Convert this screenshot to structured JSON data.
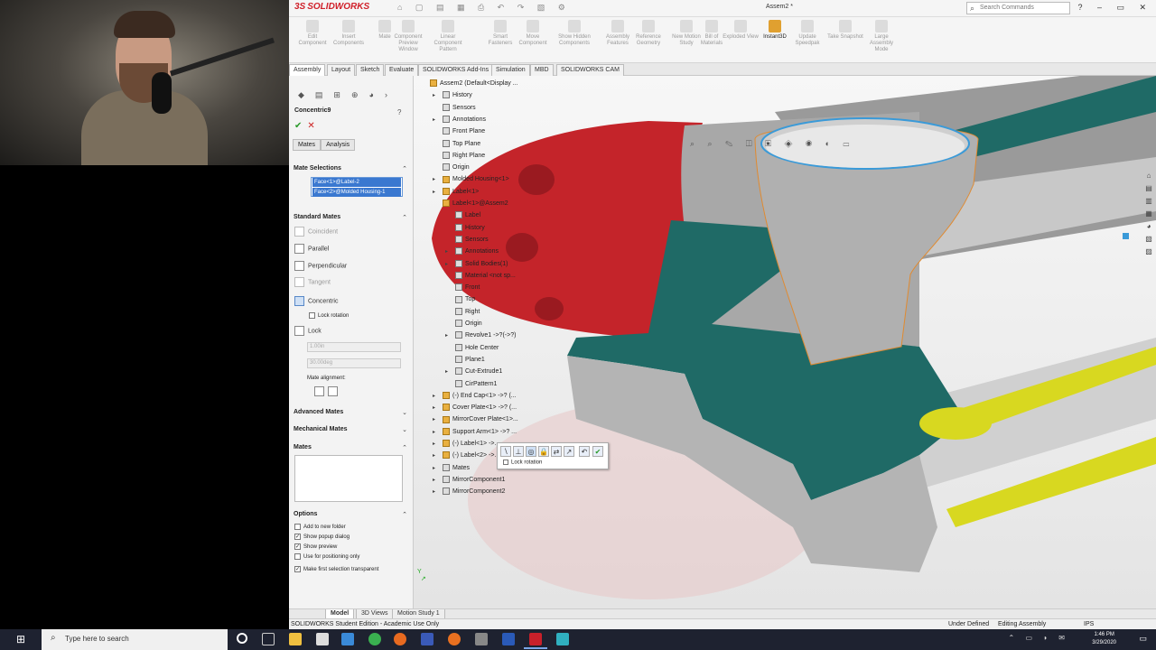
{
  "titlebar": {
    "logo": "SOLIDWORKS",
    "logo_prefix": "3S",
    "document_title": "Assem2 *",
    "search_placeholder": "Search Commands"
  },
  "ribbon": {
    "buttons": [
      {
        "label": "Edit Component",
        "icon": "edit-component-icon",
        "active": false
      },
      {
        "label": "Insert Components",
        "icon": "insert-components-icon",
        "active": false
      },
      {
        "label": "Mate",
        "icon": "mate-icon",
        "active": false
      },
      {
        "label": "Component Preview Window",
        "icon": "component-preview-icon",
        "active": false
      },
      {
        "label": "Linear Component Pattern",
        "icon": "linear-pattern-icon",
        "active": false
      },
      {
        "label": "Smart Fasteners",
        "icon": "smart-fasteners-icon",
        "active": false
      },
      {
        "label": "Move Component",
        "icon": "move-component-icon",
        "active": false
      },
      {
        "label": "Show Hidden Components",
        "icon": "show-hidden-icon",
        "active": false
      },
      {
        "label": "Assembly Features",
        "icon": "assembly-features-icon",
        "active": false
      },
      {
        "label": "Reference Geometry",
        "icon": "reference-geometry-icon",
        "active": false
      },
      {
        "label": "New Motion Study",
        "icon": "motion-study-icon",
        "active": false
      },
      {
        "label": "Bill of Materials",
        "icon": "bom-icon",
        "active": false
      },
      {
        "label": "Exploded View",
        "icon": "exploded-view-icon",
        "active": false
      },
      {
        "label": "Instant3D",
        "icon": "instant3d-icon",
        "active": true
      },
      {
        "label": "Update Speedpak",
        "icon": "speedpak-icon",
        "active": false
      },
      {
        "label": "Take Snapshot",
        "icon": "snapshot-icon",
        "active": false
      },
      {
        "label": "Large Assembly Mode",
        "icon": "large-assembly-icon",
        "active": false
      }
    ]
  },
  "tabs": [
    "Assembly",
    "Layout",
    "Sketch",
    "Evaluate",
    "SOLIDWORKS Add-Ins",
    "Simulation",
    "MBD",
    "SOLIDWORKS CAM"
  ],
  "property_manager": {
    "title": "Concentric9",
    "tab_mates": "Mates",
    "tab_analysis": "Analysis",
    "mate_selections_title": "Mate Selections",
    "selections": [
      "Face<1>@Label-2",
      "Face<2>@Molded Housing-1"
    ],
    "standard_mates_title": "Standard Mates",
    "mates": [
      {
        "label": "Coincident",
        "enabled": false
      },
      {
        "label": "Parallel",
        "enabled": true
      },
      {
        "label": "Perpendicular",
        "enabled": true
      },
      {
        "label": "Tangent",
        "enabled": false
      },
      {
        "label": "Concentric",
        "enabled": true,
        "selected": true
      }
    ],
    "lock_rotation": "Lock rotation",
    "lock": "Lock",
    "distance_value": "1.00in",
    "angle_value": "30.00deg",
    "mate_alignment": "Mate alignment:",
    "advanced_mates": "Advanced Mates",
    "mechanical_mates": "Mechanical Mates",
    "mates_list_title": "Mates",
    "options_title": "Options",
    "options": [
      {
        "label": "Add to new folder",
        "checked": false
      },
      {
        "label": "Show popup dialog",
        "checked": true
      },
      {
        "label": "Show preview",
        "checked": true
      },
      {
        "label": "Use for positioning only",
        "checked": false
      },
      {
        "label": "Make first selection transparent",
        "checked": true
      }
    ]
  },
  "tree": [
    {
      "label": "Assem2 (Default<Display ...",
      "indent": 0,
      "arrow": false,
      "yellow": true
    },
    {
      "label": "History",
      "indent": 1,
      "arrow": true
    },
    {
      "label": "Sensors",
      "indent": 1,
      "arrow": false
    },
    {
      "label": "Annotations",
      "indent": 1,
      "arrow": true
    },
    {
      "label": "Front Plane",
      "indent": 1,
      "arrow": false
    },
    {
      "label": "Top Plane",
      "indent": 1,
      "arrow": false
    },
    {
      "label": "Right Plane",
      "indent": 1,
      "arrow": false
    },
    {
      "label": "Origin",
      "indent": 1,
      "arrow": false
    },
    {
      "label": "Molded Housing<1>",
      "indent": 1,
      "arrow": true,
      "yellow": true
    },
    {
      "label": "Label<1>",
      "indent": 1,
      "arrow": true,
      "yellow": true
    },
    {
      "label": "Label<1>@Assem2",
      "indent": 1,
      "arrow": false,
      "yellow": true
    },
    {
      "label": "Label",
      "indent": 2,
      "arrow": false
    },
    {
      "label": "History",
      "indent": 2,
      "arrow": false
    },
    {
      "label": "Sensors",
      "indent": 2,
      "arrow": false
    },
    {
      "label": "Annotations",
      "indent": 2,
      "arrow": true
    },
    {
      "label": "Solid Bodies(1)",
      "indent": 2,
      "arrow": true
    },
    {
      "label": "Material <not sp...",
      "indent": 2,
      "arrow": false
    },
    {
      "label": "Front",
      "indent": 2,
      "arrow": false
    },
    {
      "label": "Top",
      "indent": 2,
      "arrow": false
    },
    {
      "label": "Right",
      "indent": 2,
      "arrow": false
    },
    {
      "label": "Origin",
      "indent": 2,
      "arrow": false
    },
    {
      "label": "Revolve1 ->?(->?)",
      "indent": 2,
      "arrow": true
    },
    {
      "label": "Hole Center",
      "indent": 2,
      "arrow": false
    },
    {
      "label": "Plane1",
      "indent": 2,
      "arrow": false
    },
    {
      "label": "Cut-Extrude1",
      "indent": 2,
      "arrow": true
    },
    {
      "label": "CirPattern1",
      "indent": 2,
      "arrow": false
    },
    {
      "label": "(-) End Cap<1> ->? (...",
      "indent": 1,
      "arrow": true,
      "yellow": true
    },
    {
      "label": "Cover Plate<1> ->? (...",
      "indent": 1,
      "arrow": true,
      "yellow": true
    },
    {
      "label": "MirrorCover Plate<1>...",
      "indent": 1,
      "arrow": true,
      "yellow": true
    },
    {
      "label": "Support Arm<1> ->? ...",
      "indent": 1,
      "arrow": true,
      "yellow": true
    },
    {
      "label": "(-) Label<1> ->...",
      "indent": 1,
      "arrow": true,
      "yellow": true
    },
    {
      "label": "(-) Label<2> ->...",
      "indent": 1,
      "arrow": true,
      "yellow": true
    },
    {
      "label": "Mates",
      "indent": 1,
      "arrow": true
    },
    {
      "label": "MirrorComponent1",
      "indent": 1,
      "arrow": true
    },
    {
      "label": "MirrorComponent2",
      "indent": 1,
      "arrow": true
    }
  ],
  "popup": {
    "lock_rotation": "Lock rotation"
  },
  "bottom_tabs": [
    "Model",
    "3D Views",
    "Motion Study 1"
  ],
  "status": {
    "left": "SOLIDWORKS Student Edition - Academic Use Only",
    "under_defined": "Under Defined",
    "editing": "Editing Assembly",
    "units": "IPS"
  },
  "taskbar": {
    "search_placeholder": "Type here to search",
    "time": "1:46 PM",
    "date": "3/29/2020"
  },
  "colors": {
    "model_red": "#c4242a",
    "model_teal": "#1f6a66",
    "model_gray": "#b8b8b8",
    "model_yellow": "#d8d820",
    "accent_blue": "#3a78d0"
  }
}
